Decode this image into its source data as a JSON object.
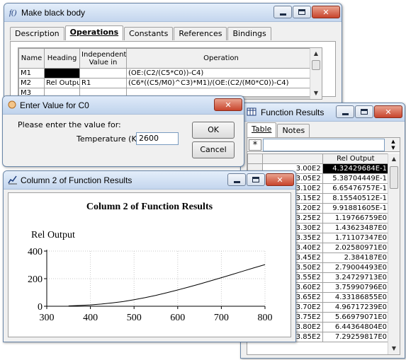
{
  "blackbody": {
    "title": "Make black body",
    "tabs": [
      "Description",
      "Operations",
      "Constants",
      "References",
      "Bindings"
    ],
    "selected_tab": "Operations",
    "columns": [
      "Name",
      "Heading",
      "Independent Value in",
      "Operation"
    ],
    "rows": [
      {
        "name": "M1",
        "heading": "",
        "independent": "",
        "operation": "(OE:(C2/(C5*C0))-C4)"
      },
      {
        "name": "M2",
        "heading": "Rel Outpu",
        "independent": "R1",
        "operation": "(C6*((C5/M0)^C3)*M1)/(OE:(C2/(M0*C0))-C4)"
      },
      {
        "name": "M3",
        "heading": "",
        "independent": "",
        "operation": ""
      }
    ]
  },
  "enter_value": {
    "title": "Enter Value for C0",
    "prompt": "Please enter the value for:",
    "field_label": "Temperature (K)",
    "field_value": "2600",
    "ok_label": "OK",
    "cancel_label": "Cancel"
  },
  "function_results": {
    "title": "Function Results",
    "tabs": [
      "Table",
      "Notes"
    ],
    "selected_tab": "Table",
    "row_header_symbol": "*",
    "column_header": "Rel Output",
    "rows": [
      {
        "x": "3.00E2",
        "value": "4.32429684E-1"
      },
      {
        "x": "3.05E2",
        "value": "5.38704449E-1"
      },
      {
        "x": "3.10E2",
        "value": "6.65476757E-1"
      },
      {
        "x": "3.15E2",
        "value": "8.15540512E-1"
      },
      {
        "x": "3.20E2",
        "value": "9.91881605E-1"
      },
      {
        "x": "3.25E2",
        "value": "1.19766759E0"
      },
      {
        "x": "3.30E2",
        "value": "1.43623487E0"
      },
      {
        "x": "3.35E2",
        "value": "1.71107347E0"
      },
      {
        "x": "3.40E2",
        "value": "2.02580971E0"
      },
      {
        "x": "3.45E2",
        "value": "2.384187E0"
      },
      {
        "x": "3.50E2",
        "value": "2.79004493E0"
      },
      {
        "x": "3.55E2",
        "value": "3.24729713E0"
      },
      {
        "x": "3.60E2",
        "value": "3.75990796E0"
      },
      {
        "x": "3.65E2",
        "value": "4.33186855E0"
      },
      {
        "x": "3.70E2",
        "value": "4.96717239E0"
      },
      {
        "x": "3.75E2",
        "value": "5.66979071E0"
      },
      {
        "x": "3.80E2",
        "value": "6.44364804E0"
      },
      {
        "x": "3.85E2",
        "value": "7.29259817E0"
      }
    ]
  },
  "chart_window": {
    "title": "Column 2 of Function Results"
  },
  "chart_data": {
    "type": "line",
    "title": "Column 2 of Function Results",
    "ylabel": "Rel Output",
    "xlabel": "",
    "xlim": [
      300,
      800
    ],
    "ylim": [
      0,
      400
    ],
    "xticks": [
      300,
      400,
      500,
      600,
      700,
      800
    ],
    "yticks": [
      0,
      200,
      400
    ],
    "grid": true,
    "series": [
      {
        "x": [
          350,
          375,
          400,
          425,
          450,
          475,
          500,
          525,
          550,
          575,
          600,
          625,
          650,
          675,
          700,
          725,
          750,
          775,
          800
        ],
        "values": [
          2.8,
          5.7,
          10,
          16,
          24,
          34,
          47,
          62,
          79,
          98,
          118,
          139,
          161,
          184,
          207,
          231,
          255,
          279,
          302
        ]
      }
    ]
  }
}
